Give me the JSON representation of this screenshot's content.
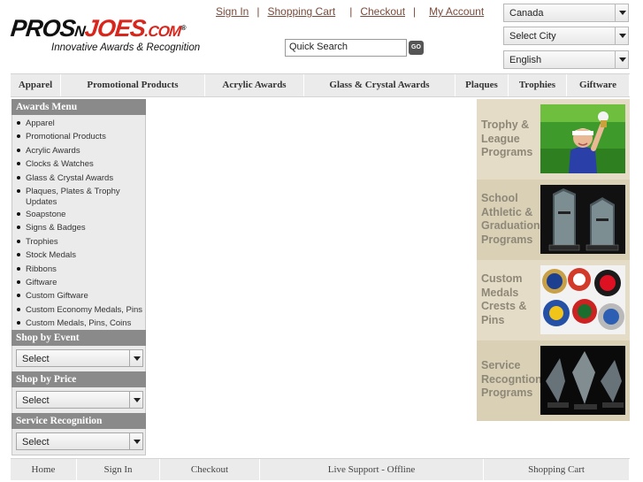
{
  "logo": {
    "part1": "PROS",
    "part2": "N",
    "part3": "JOES",
    "part4": ".COM",
    "trademark": "®",
    "tagline": "Innovative Awards & Recognition"
  },
  "top_links": {
    "sign_in": "Sign In",
    "shopping_cart": "Shopping Cart",
    "checkout": "Checkout",
    "my_account": "My Account",
    "separator": "|"
  },
  "search": {
    "value": "Quick Search",
    "go_label": "GO"
  },
  "selects": {
    "country": "Canada",
    "city": "Select City",
    "language": "English"
  },
  "nav": [
    "Apparel",
    "Promotional Products",
    "Acrylic Awards",
    "Glass & Crystal Awards",
    "Plaques",
    "Trophies",
    "Giftware"
  ],
  "sidebar": {
    "awards_menu_title": "Awards Menu",
    "awards_menu": [
      "Apparel",
      "Promotional Products",
      "Acrylic Awards",
      "Clocks & Watches",
      "Glass & Crystal Awards",
      "Plaques, Plates & Trophy Updates",
      "Soapstone",
      "Signs & Badges",
      "Trophies",
      "Stock Medals",
      "Ribbons",
      "Giftware",
      "Custom Giftware",
      "Custom Economy Medals, Pins",
      "Custom Medals, Pins, Coins"
    ],
    "event_title": "Shop by Event",
    "event_select": "Select",
    "price_title": "Shop by Price",
    "price_select": "Select",
    "service_title": "Service Recognition",
    "service_select": "Select"
  },
  "promos": [
    {
      "lines": [
        "Trophy &",
        "League",
        "Programs"
      ]
    },
    {
      "lines": [
        "School",
        "Athletic &",
        "Graduation",
        "Programs"
      ]
    },
    {
      "lines": [
        "Custom",
        "Medals",
        "Crests &",
        "Pins"
      ]
    },
    {
      "lines": [
        "Service",
        "Recogntion",
        "Programs"
      ]
    }
  ],
  "footer": [
    "Home",
    "Sign In",
    "Checkout",
    "Live Support - Offline",
    "Shopping Cart"
  ],
  "colors": {
    "logo_red": "#d8261c",
    "link_brown": "#7a4a3a",
    "sidebar_header": "#8a8a8a",
    "promo_bg": "#e4dcc6",
    "promo_text": "#8f8878"
  }
}
